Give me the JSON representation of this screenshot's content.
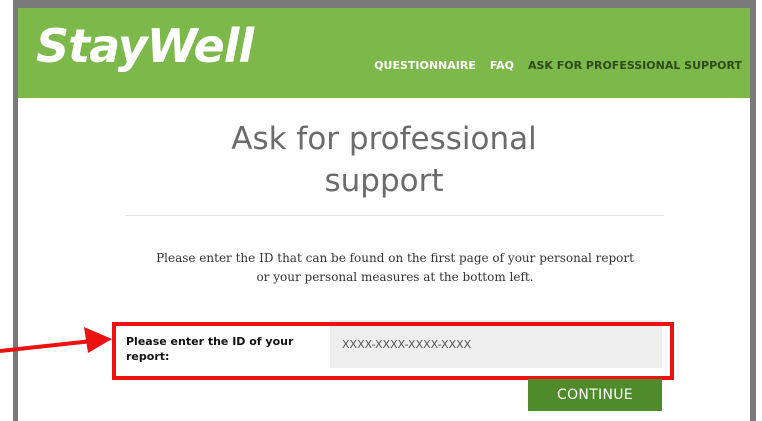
{
  "header": {
    "logo": "StayWell",
    "nav": [
      {
        "label": "QUESTIONNAIRE",
        "active": false
      },
      {
        "label": "FAQ",
        "active": false
      },
      {
        "label": "ASK FOR PROFESSIONAL SUPPORT",
        "active": true
      }
    ]
  },
  "page": {
    "title_line1": "Ask for professional",
    "title_line2": "support",
    "instructions_line1": "Please enter the ID that can be found on the first page of your personal report",
    "instructions_line2": "or your personal measures at the bottom left."
  },
  "form": {
    "id_label_line1": "Please enter the ID of your",
    "id_label_line2": "report:",
    "id_placeholder": "XXXX-XXXX-XXXX-XXXX",
    "id_value": "",
    "continue_label": "CONTINUE"
  },
  "colors": {
    "brand_green": "#7cb84a",
    "button_green": "#4f8a2b",
    "annotation_red": "#ee1111"
  }
}
